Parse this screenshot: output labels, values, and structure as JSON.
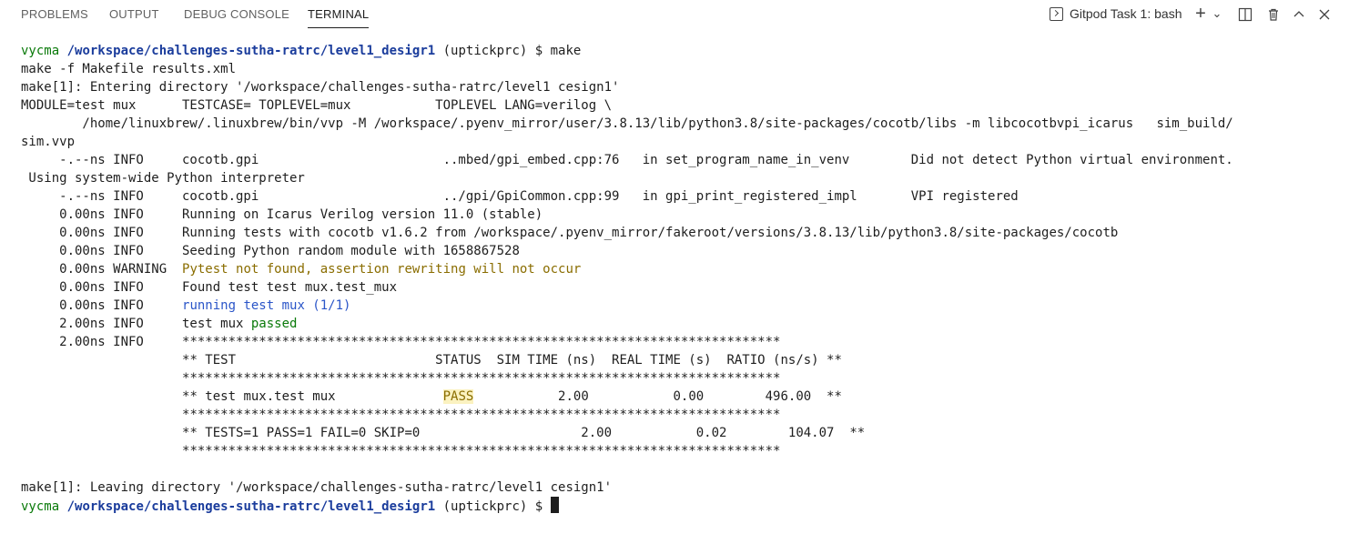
{
  "panel": {
    "tabs": [
      {
        "label": "PROBLEMS"
      },
      {
        "label": "OUTPUT"
      },
      {
        "label": "DEBUG CONSOLE"
      },
      {
        "label": "TERMINAL"
      }
    ],
    "task_label": "Gitpod Task 1: bash",
    "buttons": {
      "add": "+",
      "split_dropdown": "⌄",
      "split": "▯",
      "trash": "🗑",
      "maximize": "⌃",
      "close": "✕"
    }
  },
  "terminal": {
    "user": "vycma",
    "path": "/workspace/challenges-sutha-ratrc/level1_desigr1",
    "venv": "(uptickprc) $ ",
    "cmd": "make",
    "lines": [
      "make -f Makefile results.xml",
      "make[1]: Entering directory '/workspace/challenges-sutha-ratrc/level1 cesign1'",
      "MODULE=test mux      TESTCASE= TOPLEVEL=mux           TOPLEVEL LANG=verilog \\",
      "        /home/linuxbrew/.linuxbrew/bin/vvp -M /workspace/.pyenv_mirror/user/3.8.13/lib/python3.8/site-packages/cocotb/libs -m libcocotbvpi_icarus   sim_build/",
      "sim.vvp",
      "     -.--ns INFO     cocotb.gpi                        ..mbed/gpi_embed.cpp:76   in set_program_name_in_venv        Did not detect Python virtual environment.",
      " Using system-wide Python interpreter",
      "     -.--ns INFO     cocotb.gpi                        ../gpi/GpiCommon.cpp:99   in gpi_print_registered_impl       VPI registered",
      "     0.00ns INFO     Running on Icarus Verilog version 11.0 (stable)",
      "     0.00ns INFO     Running tests with cocotb v1.6.2 from /workspace/.pyenv_mirror/fakeroot/versions/3.8.13/lib/python3.8/site-packages/cocotb",
      "     0.00ns INFO     Seeding Python random module with 1658867528"
    ],
    "warn_prefix": "     0.00ns WARNING  ",
    "warn_text": "Pytest not found, assertion rewriting will not occur",
    "found_line": "     0.00ns INFO     Found test test mux.test_mux",
    "run_prefix": "     0.00ns INFO     ",
    "run_text": "running test mux (1/1)",
    "pass_prefix": "     2.00ns INFO     test mux ",
    "pass_word": "passed",
    "stars_prefix": "     2.00ns INFO     ",
    "stars": "******************************************************************************",
    "indent": "                     ",
    "hdr": "** TEST                          STATUS  SIM TIME (ns)  REAL TIME (s)  RATIO (ns/s) **",
    "row_a": "** test mux.test mux              ",
    "row_status": "PASS",
    "row_b": "           2.00           0.00        496.00  **",
    "summary": "** TESTS=1 PASS=1 FAIL=0 SKIP=0                     2.00           0.02        104.07  **",
    "leaving": "make[1]: Leaving directory '/workspace/challenges-sutha-ratrc/level1 cesign1'"
  }
}
